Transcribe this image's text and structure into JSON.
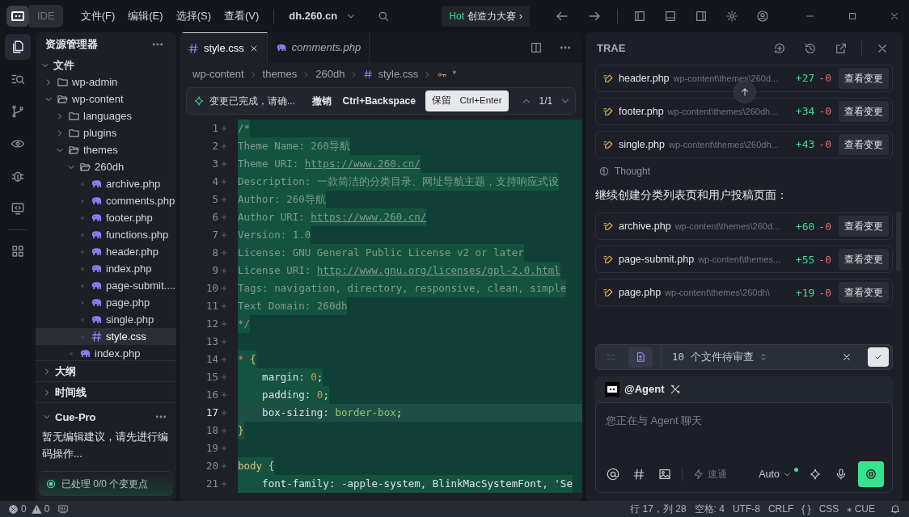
{
  "title_bar": {
    "product": "IDE",
    "menus": [
      "文件(F)",
      "编辑(E)",
      "选择(S)",
      "查看(V)"
    ],
    "project": "dh.260.cn",
    "promo_tag": "Hot",
    "promo": "创造力大赛",
    "promo_arrow": "›"
  },
  "activity_bar": [
    {
      "kind": "files",
      "selected": true
    },
    {
      "kind": "search",
      "selected": false
    },
    {
      "kind": "git",
      "selected": false
    },
    {
      "kind": "eye",
      "selected": false
    },
    {
      "kind": "bug",
      "selected": false
    },
    {
      "kind": "remote",
      "selected": false
    },
    {
      "kind": "apps",
      "selected": false
    }
  ],
  "sidebar": {
    "title": "资源管理器",
    "section": "文件",
    "tree": [
      {
        "label": "wp-admin",
        "kind": "folder",
        "expanded": false,
        "selected": false
      },
      {
        "label": "wp-content",
        "kind": "folder",
        "expanded": true,
        "selected": false,
        "children": [
          {
            "label": "languages",
            "kind": "folder",
            "expanded": false,
            "selected": false
          },
          {
            "label": "plugins",
            "kind": "folder",
            "expanded": false,
            "selected": false
          },
          {
            "label": "themes",
            "kind": "folder",
            "expanded": true,
            "selected": false,
            "children": [
              {
                "label": "260dh",
                "kind": "folder",
                "expanded": true,
                "selected": false,
                "children": [
                  {
                    "label": "archive.php",
                    "kind": "php",
                    "selected": false
                  },
                  {
                    "label": "comments.php",
                    "kind": "php",
                    "selected": false
                  },
                  {
                    "label": "footer.php",
                    "kind": "php",
                    "selected": false
                  },
                  {
                    "label": "functions.php",
                    "kind": "php",
                    "selected": false
                  },
                  {
                    "label": "header.php",
                    "kind": "php",
                    "selected": false
                  },
                  {
                    "label": "index.php",
                    "kind": "php",
                    "selected": false
                  },
                  {
                    "label": "page-submit....",
                    "kind": "php",
                    "selected": false
                  },
                  {
                    "label": "page.php",
                    "kind": "php",
                    "selected": false
                  },
                  {
                    "label": "single.php",
                    "kind": "php",
                    "selected": false
                  },
                  {
                    "label": "style.css",
                    "kind": "css",
                    "selected": true
                  }
                ]
              },
              {
                "label": "index.php",
                "kind": "php",
                "selected": false
              }
            ]
          }
        ]
      }
    ],
    "sections": [
      {
        "label": "大纲",
        "expanded": false
      },
      {
        "label": "时间线",
        "expanded": false
      }
    ],
    "cue_pro": {
      "title": "Cue-Pro",
      "message": "暂无编辑建议，请先进行编码操作...",
      "status": "已处理 0/0 个变更点"
    }
  },
  "editor": {
    "tabs": [
      {
        "label": "style.css",
        "kind": "css",
        "selected": true,
        "preview": false
      },
      {
        "label": "comments.php",
        "kind": "php",
        "selected": false,
        "preview": true
      }
    ],
    "breadcrumb": [
      "wp-content",
      "themes",
      "260dh",
      "style.css",
      "*"
    ],
    "change_bar": {
      "message": "变更已完成，请确...",
      "undo": "撤销",
      "undo_key": "Ctrl+Backspace",
      "keep": "保留",
      "keep_key": "Ctrl+Enter",
      "counter": "1/1"
    },
    "lines": [
      {
        "number": "1",
        "added": true,
        "current": false,
        "tokens": [
          {
            "text": "/*",
            "kind": "comment"
          }
        ]
      },
      {
        "number": "2",
        "added": true,
        "current": false,
        "tokens": [
          {
            "text": "Theme Name: 260导航",
            "kind": "comment"
          }
        ]
      },
      {
        "number": "3",
        "added": true,
        "current": false,
        "tokens": [
          {
            "text": "Theme URI: ",
            "kind": "comment"
          },
          {
            "text": "https://www.260.cn/",
            "kind": "link"
          }
        ]
      },
      {
        "number": "4",
        "added": true,
        "current": false,
        "tokens": [
          {
            "text": "Description: 一款简洁的分类目录、网址导航主题，支持响应式设",
            "kind": "comment"
          }
        ]
      },
      {
        "number": "5",
        "added": true,
        "current": false,
        "tokens": [
          {
            "text": "Author: 260导航",
            "kind": "comment"
          }
        ]
      },
      {
        "number": "6",
        "added": true,
        "current": false,
        "tokens": [
          {
            "text": "Author URI: ",
            "kind": "comment"
          },
          {
            "text": "https://www.260.cn/",
            "kind": "link"
          }
        ]
      },
      {
        "number": "7",
        "added": true,
        "current": false,
        "tokens": [
          {
            "text": "Version: 1.0",
            "kind": "comment"
          }
        ]
      },
      {
        "number": "8",
        "added": true,
        "current": false,
        "tokens": [
          {
            "text": "License: GNU General Public License v2 or later",
            "kind": "comment"
          }
        ]
      },
      {
        "number": "9",
        "added": true,
        "current": false,
        "tokens": [
          {
            "text": "License URI: ",
            "kind": "comment"
          },
          {
            "text": "http://www.gnu.org/licenses/gpl-2.0.html",
            "kind": "link"
          }
        ]
      },
      {
        "number": "10",
        "added": true,
        "current": false,
        "tokens": [
          {
            "text": "Tags: navigation, directory, responsive, clean, simple",
            "kind": "comment"
          }
        ]
      },
      {
        "number": "11",
        "added": true,
        "current": false,
        "tokens": [
          {
            "text": "Text Domain: 260dh",
            "kind": "comment"
          }
        ]
      },
      {
        "number": "12",
        "added": true,
        "current": false,
        "tokens": [
          {
            "text": "*/",
            "kind": "comment"
          }
        ]
      },
      {
        "number": "13",
        "added": true,
        "current": false
      },
      {
        "number": "14",
        "added": true,
        "current": false,
        "tokens": [
          {
            "text": "*",
            "kind": "selector"
          },
          {
            "text": " {",
            "kind": "brace"
          }
        ]
      },
      {
        "number": "15",
        "added": true,
        "current": false,
        "tokens": [
          {
            "text": "    margin",
            "kind": "property"
          },
          {
            "text": ": ",
            "kind": "plain"
          },
          {
            "text": "0",
            "kind": "number"
          },
          {
            "text": ";",
            "kind": "plain"
          }
        ]
      },
      {
        "number": "16",
        "added": true,
        "current": false,
        "tokens": [
          {
            "text": "    padding",
            "kind": "property"
          },
          {
            "text": ": ",
            "kind": "plain"
          },
          {
            "text": "0",
            "kind": "number"
          },
          {
            "text": ";",
            "kind": "plain"
          }
        ]
      },
      {
        "number": "17",
        "added": true,
        "current": true,
        "tokens": [
          {
            "text": "    box-sizing",
            "kind": "property"
          },
          {
            "text": ": ",
            "kind": "plain"
          },
          {
            "text": "border-box",
            "kind": "value"
          },
          {
            "text": ";",
            "kind": "plain"
          }
        ]
      },
      {
        "number": "18",
        "added": true,
        "current": false,
        "tokens": [
          {
            "text": "}",
            "kind": "brace"
          }
        ]
      },
      {
        "number": "19",
        "added": true,
        "current": false
      },
      {
        "number": "20",
        "added": true,
        "current": false,
        "tokens": [
          {
            "text": "body",
            "kind": "tag"
          },
          {
            "text": " {",
            "kind": "brace"
          }
        ]
      },
      {
        "number": "21",
        "added": true,
        "current": false,
        "tokens": [
          {
            "text": "    font-family",
            "kind": "property"
          },
          {
            "text": ": -apple-system, BlinkMacSystemFont, 'Se",
            "kind": "plain"
          }
        ]
      }
    ]
  },
  "agent_panel": {
    "title": "TRAE",
    "feed": [
      {
        "kind": "change",
        "file": "header.php",
        "path": "wp-content\\themes\\260d...",
        "added": "+27",
        "removed": "-0",
        "action": "查看变更"
      },
      {
        "kind": "change",
        "file": "footer.php",
        "path": "wp-content\\themes\\260dh...",
        "added": "+34",
        "removed": "-0",
        "action": "查看变更"
      },
      {
        "kind": "change",
        "file": "single.php",
        "path": "wp-content\\themes\\260dh...",
        "added": "+43",
        "removed": "-0",
        "action": "查看变更"
      },
      {
        "kind": "thought",
        "text": "Thought"
      },
      {
        "kind": "message",
        "text": "继续创建分类列表页和用户投稿页面："
      },
      {
        "kind": "change",
        "file": "archive.php",
        "path": "wp-content\\themes\\260d...",
        "added": "+60",
        "removed": "-0",
        "action": "查看变更"
      },
      {
        "kind": "change",
        "file": "page-submit.php",
        "path": "wp-content\\themes...",
        "added": "+55",
        "removed": "-0",
        "action": "查看变更"
      },
      {
        "kind": "change",
        "file": "page.php",
        "path": "wp-content\\themes\\260dh\\",
        "added": "+19",
        "removed": "-0",
        "action": "查看变更"
      }
    ],
    "review": {
      "text": "10 个文件待审查"
    },
    "chat": {
      "agent": "@Agent",
      "placeholder": "您正在与 Agent 聊天",
      "mode": "速通",
      "model": "Auto"
    }
  },
  "status_bar": {
    "errors": "0",
    "warnings": "0",
    "items": [
      "行 17，列 28",
      "空格: 4",
      "UTF-8",
      "CRLF",
      "{ }",
      "CSS",
      "⁎ CUE"
    ]
  }
}
